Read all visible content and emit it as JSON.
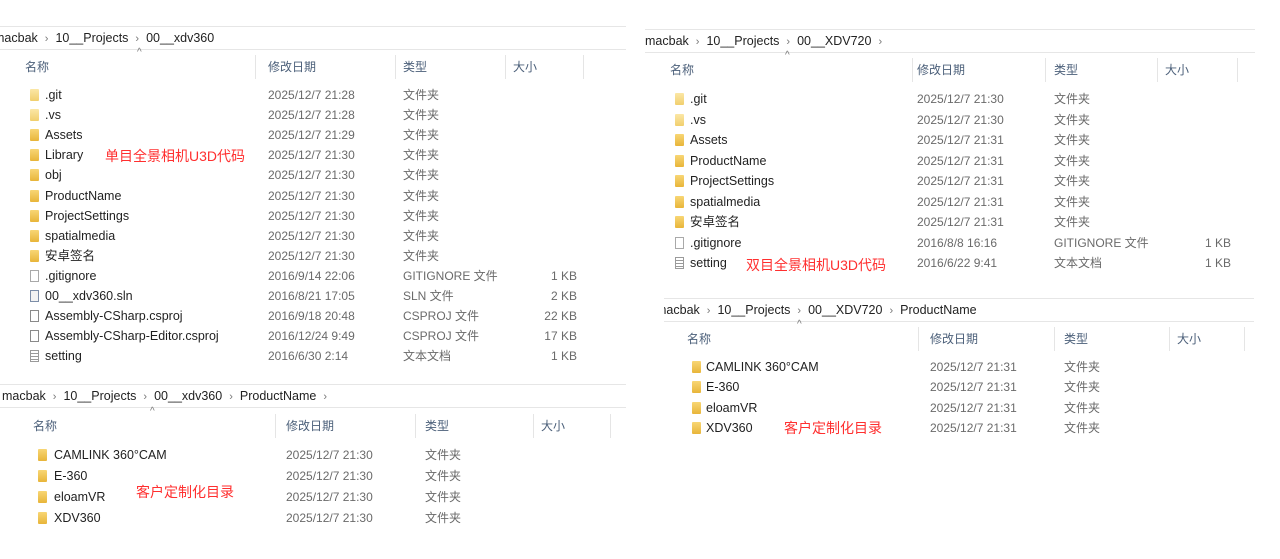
{
  "colors": {
    "annotation": "#ff2f2f",
    "folder": "#f0c04a",
    "header_text": "#4c607a"
  },
  "columns": {
    "name": "名称",
    "modified": "修改日期",
    "type": "类型",
    "size": "大小"
  },
  "panel_a": {
    "breadcrumb": [
      "macbak",
      "10__Projects",
      "00__xdv360"
    ],
    "note": "单目全景相机U3D代码",
    "rows": [
      {
        "icon": "folder-light-icon",
        "name": ".git",
        "modified": "2025/12/7 21:28",
        "type": "文件夹",
        "size": ""
      },
      {
        "icon": "folder-light-icon",
        "name": ".vs",
        "modified": "2025/12/7 21:28",
        "type": "文件夹",
        "size": ""
      },
      {
        "icon": "folder-icon",
        "name": "Assets",
        "modified": "2025/12/7 21:29",
        "type": "文件夹",
        "size": ""
      },
      {
        "icon": "folder-icon",
        "name": "Library",
        "modified": "2025/12/7 21:30",
        "type": "文件夹",
        "size": ""
      },
      {
        "icon": "folder-icon",
        "name": "obj",
        "modified": "2025/12/7 21:30",
        "type": "文件夹",
        "size": ""
      },
      {
        "icon": "folder-icon",
        "name": "ProductName",
        "modified": "2025/12/7 21:30",
        "type": "文件夹",
        "size": ""
      },
      {
        "icon": "folder-icon",
        "name": "ProjectSettings",
        "modified": "2025/12/7 21:30",
        "type": "文件夹",
        "size": ""
      },
      {
        "icon": "folder-icon",
        "name": "spatialmedia",
        "modified": "2025/12/7 21:30",
        "type": "文件夹",
        "size": ""
      },
      {
        "icon": "folder-icon",
        "name": "安卓签名",
        "modified": "2025/12/7 21:30",
        "type": "文件夹",
        "size": ""
      },
      {
        "icon": "file-icon",
        "name": ".gitignore",
        "modified": "2016/9/14 22:06",
        "type": "GITIGNORE 文件",
        "size": "1 KB"
      },
      {
        "icon": "sln-icon",
        "name": "00__xdv360.sln",
        "modified": "2016/8/21 17:05",
        "type": "SLN 文件",
        "size": "2 KB"
      },
      {
        "icon": "csproj-icon",
        "name": "Assembly-CSharp.csproj",
        "modified": "2016/9/18 20:48",
        "type": "CSPROJ 文件",
        "size": "22 KB"
      },
      {
        "icon": "csproj-icon",
        "name": "Assembly-CSharp-Editor.csproj",
        "modified": "2016/12/24 9:49",
        "type": "CSPROJ 文件",
        "size": "17 KB"
      },
      {
        "icon": "text-file-icon",
        "name": "setting",
        "modified": "2016/6/30 2:14",
        "type": "文本文档",
        "size": "1 KB"
      }
    ]
  },
  "panel_b": {
    "breadcrumb": [
      "macbak",
      "10__Projects",
      "00__xdv360",
      "ProductName"
    ],
    "note": "客户定制化目录",
    "rows": [
      {
        "icon": "folder-icon",
        "name": "CAMLINK 360°CAM",
        "modified": "2025/12/7 21:30",
        "type": "文件夹",
        "size": ""
      },
      {
        "icon": "folder-icon",
        "name": "E-360",
        "modified": "2025/12/7 21:30",
        "type": "文件夹",
        "size": ""
      },
      {
        "icon": "folder-icon",
        "name": "eloamVR",
        "modified": "2025/12/7 21:30",
        "type": "文件夹",
        "size": ""
      },
      {
        "icon": "folder-icon",
        "name": "XDV360",
        "modified": "2025/12/7 21:30",
        "type": "文件夹",
        "size": ""
      }
    ]
  },
  "panel_c": {
    "breadcrumb": [
      "macbak",
      "10__Projects",
      "00__XDV720"
    ],
    "note": "双目全景相机U3D代码",
    "rows": [
      {
        "icon": "folder-light-icon",
        "name": ".git",
        "modified": "2025/12/7 21:30",
        "type": "文件夹",
        "size": ""
      },
      {
        "icon": "folder-light-icon",
        "name": ".vs",
        "modified": "2025/12/7 21:30",
        "type": "文件夹",
        "size": ""
      },
      {
        "icon": "folder-icon",
        "name": "Assets",
        "modified": "2025/12/7 21:31",
        "type": "文件夹",
        "size": ""
      },
      {
        "icon": "folder-icon",
        "name": "ProductName",
        "modified": "2025/12/7 21:31",
        "type": "文件夹",
        "size": ""
      },
      {
        "icon": "folder-icon",
        "name": "ProjectSettings",
        "modified": "2025/12/7 21:31",
        "type": "文件夹",
        "size": ""
      },
      {
        "icon": "folder-icon",
        "name": "spatialmedia",
        "modified": "2025/12/7 21:31",
        "type": "文件夹",
        "size": ""
      },
      {
        "icon": "folder-icon",
        "name": "安卓签名",
        "modified": "2025/12/7 21:31",
        "type": "文件夹",
        "size": ""
      },
      {
        "icon": "file-icon",
        "name": ".gitignore",
        "modified": "2016/8/8 16:16",
        "type": "GITIGNORE 文件",
        "size": "1 KB"
      },
      {
        "icon": "text-file-icon",
        "name": "setting",
        "modified": "2016/6/22 9:41",
        "type": "文本文档",
        "size": "1 KB"
      }
    ]
  },
  "panel_d": {
    "breadcrumb": [
      "macbak",
      "10__Projects",
      "00__XDV720",
      "ProductName"
    ],
    "note": "客户定制化目录",
    "rows": [
      {
        "icon": "folder-icon",
        "name": "CAMLINK 360°CAM",
        "modified": "2025/12/7 21:31",
        "type": "文件夹",
        "size": ""
      },
      {
        "icon": "folder-icon",
        "name": "E-360",
        "modified": "2025/12/7 21:31",
        "type": "文件夹",
        "size": ""
      },
      {
        "icon": "folder-icon",
        "name": "eloamVR",
        "modified": "2025/12/7 21:31",
        "type": "文件夹",
        "size": ""
      },
      {
        "icon": "folder-icon",
        "name": "XDV360",
        "modified": "2025/12/7 21:31",
        "type": "文件夹",
        "size": ""
      }
    ]
  }
}
